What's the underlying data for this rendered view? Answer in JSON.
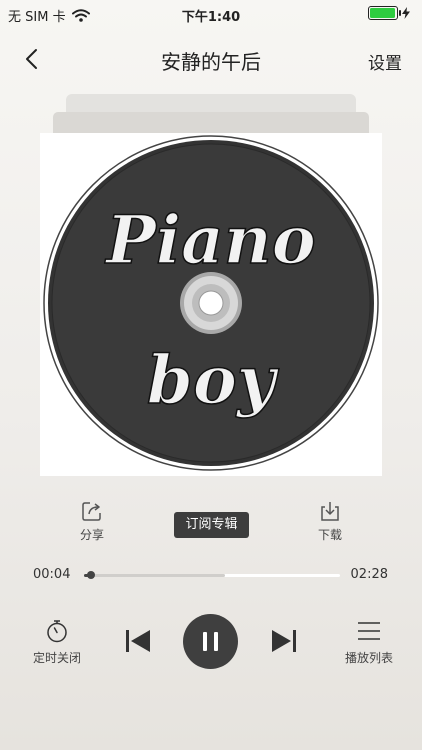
{
  "status_bar": {
    "carrier": "无 SIM 卡",
    "time": "下午1:40",
    "battery_level": 0.95
  },
  "nav": {
    "title": "安静的午后",
    "settings_label": "设置"
  },
  "album": {
    "title_line1": "Piano",
    "title_line2": "boy"
  },
  "actions": {
    "share_label": "分享",
    "subscribe_label": "订阅专辑",
    "download_label": "下载"
  },
  "progress": {
    "current": "00:04",
    "total": "02:28",
    "played_fraction": 0.027,
    "buffered_fraction": 0.55
  },
  "controls": {
    "timer_label": "定时关闭",
    "playlist_label": "播放列表",
    "state": "playing"
  },
  "colors": {
    "accent": "#3d3d3d",
    "battery_fill": "#2ecc40"
  }
}
